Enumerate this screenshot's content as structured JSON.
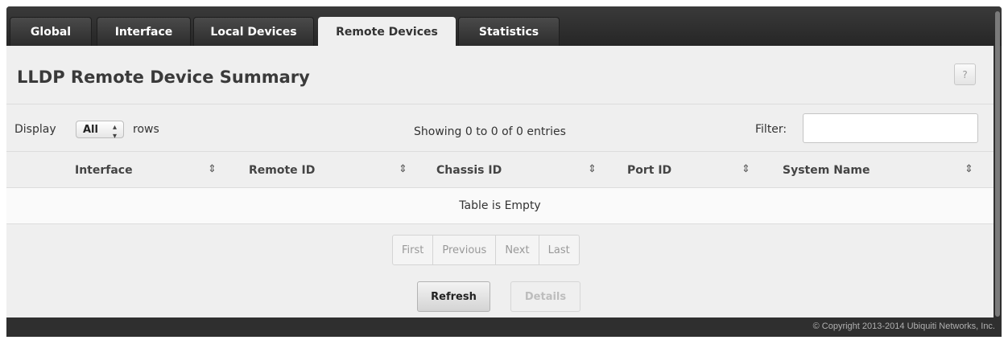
{
  "tabs": [
    {
      "label": "Global",
      "active": false
    },
    {
      "label": "Interface",
      "active": false
    },
    {
      "label": "Local Devices",
      "active": false
    },
    {
      "label": "Remote Devices",
      "active": true
    },
    {
      "label": "Statistics",
      "active": false
    }
  ],
  "page": {
    "title": "LLDP Remote Device Summary",
    "help_label": "?"
  },
  "controls": {
    "display_label": "Display",
    "rows_selected": "All",
    "rows_label": "rows",
    "entries_info": "Showing 0 to 0 of 0 entries",
    "filter_label": "Filter:",
    "filter_value": ""
  },
  "table": {
    "columns": [
      "Interface",
      "Remote ID",
      "Chassis ID",
      "Port ID",
      "System Name"
    ],
    "empty_message": "Table is Empty"
  },
  "pagination": [
    "First",
    "Previous",
    "Next",
    "Last"
  ],
  "buttons": {
    "refresh": "Refresh",
    "details": "Details"
  },
  "footer": {
    "copyright": "© Copyright 2013-2014 Ubiquiti Networks, Inc."
  },
  "colors": {
    "tab_bar": "#2f2f2f",
    "panel_bg": "#efefef",
    "active_tab_bg": "#efefef"
  }
}
